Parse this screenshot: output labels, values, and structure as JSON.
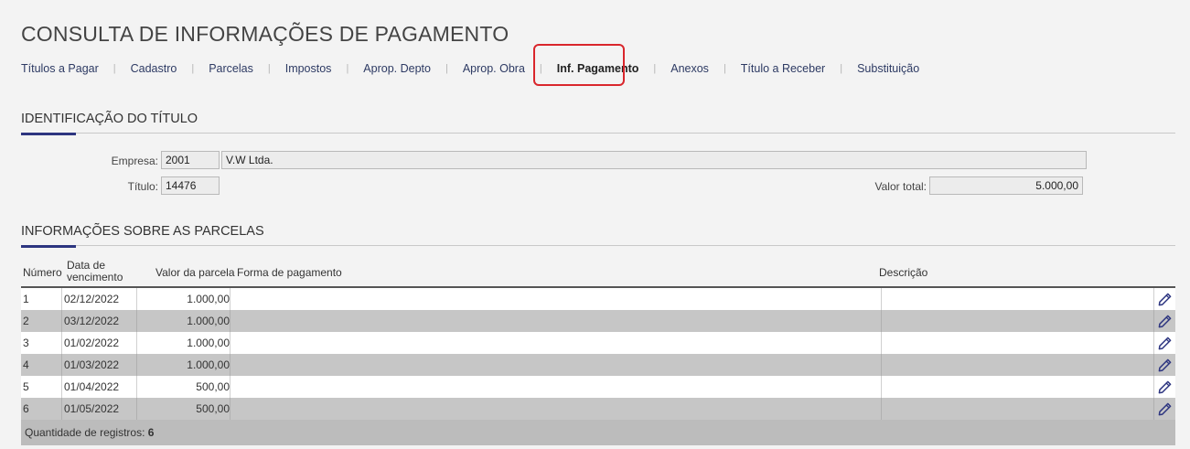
{
  "page": {
    "title": "CONSULTA DE INFORMAÇÕES DE PAGAMENTO"
  },
  "tabs": [
    {
      "label": "Títulos a Pagar"
    },
    {
      "label": "Cadastro"
    },
    {
      "label": "Parcelas"
    },
    {
      "label": "Impostos"
    },
    {
      "label": "Aprop. Depto"
    },
    {
      "label": "Aprop. Obra"
    },
    {
      "label": "Inf. Pagamento",
      "active": true
    },
    {
      "label": "Anexos"
    },
    {
      "label": "Título a Receber"
    },
    {
      "label": "Substituição"
    }
  ],
  "identificacao": {
    "title": "IDENTIFICAÇÃO DO TÍTULO",
    "empresa_label": "Empresa:",
    "empresa_code": "2001",
    "empresa_name": "V.W Ltda.",
    "titulo_label": "Título:",
    "titulo_value": "14476",
    "valor_total_label": "Valor total:",
    "valor_total_value": "5.000,00"
  },
  "parcelas": {
    "title": "INFORMAÇÕES SOBRE AS PARCELAS",
    "headers": {
      "numero": "Número",
      "data_venc_1": "Data de",
      "data_venc_2": "vencimento",
      "valor": "Valor da parcela",
      "forma": "Forma de pagamento",
      "descricao": "Descrição"
    },
    "rows": [
      {
        "numero": "1",
        "data": "02/12/2022",
        "valor": "1.000,00",
        "forma": "",
        "descricao": ""
      },
      {
        "numero": "2",
        "data": "03/12/2022",
        "valor": "1.000,00",
        "forma": "",
        "descricao": ""
      },
      {
        "numero": "3",
        "data": "01/02/2022",
        "valor": "1.000,00",
        "forma": "",
        "descricao": ""
      },
      {
        "numero": "4",
        "data": "01/03/2022",
        "valor": "1.000,00",
        "forma": "",
        "descricao": ""
      },
      {
        "numero": "5",
        "data": "01/04/2022",
        "valor": "500,00",
        "forma": "",
        "descricao": ""
      },
      {
        "numero": "6",
        "data": "01/05/2022",
        "valor": "500,00",
        "forma": "",
        "descricao": ""
      }
    ],
    "footer_label": "Quantidade de registros:",
    "footer_count": "6"
  },
  "colors": {
    "accent": "#2d3580",
    "highlight": "#d9262c",
    "edit_icon": "#2d3580"
  }
}
